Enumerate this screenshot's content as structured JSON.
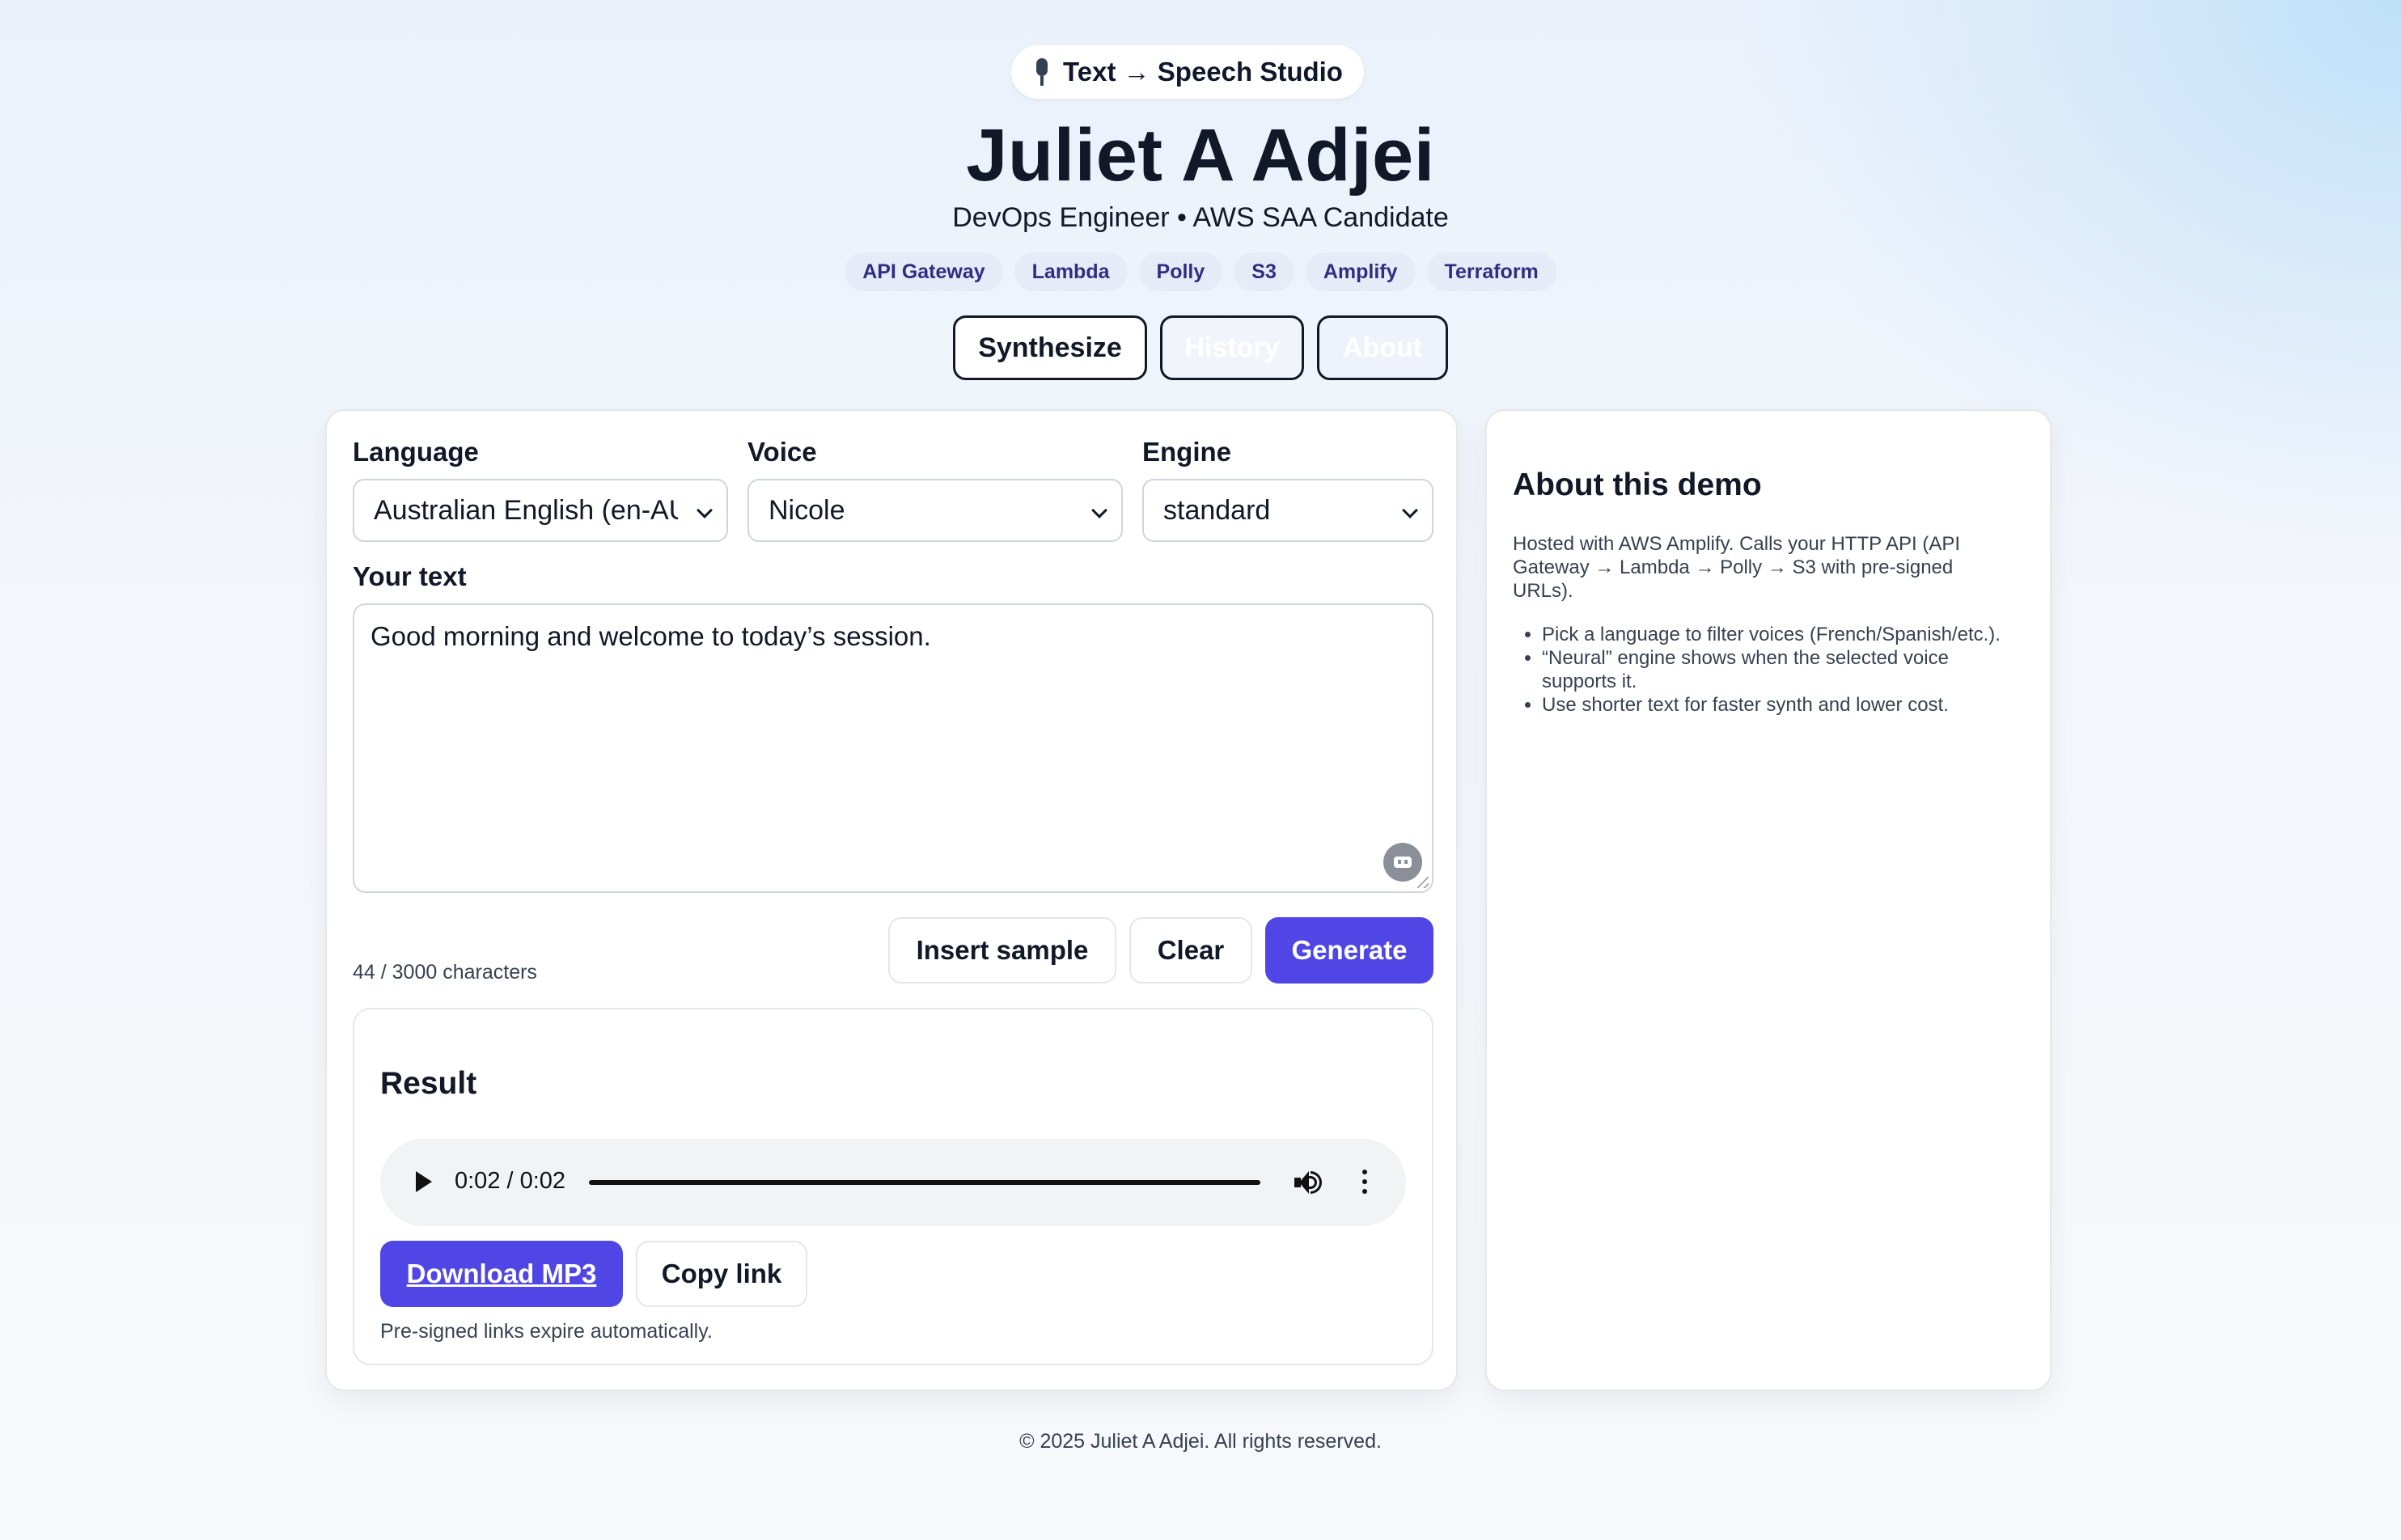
{
  "header": {
    "pill_label": "Text → Speech Studio",
    "name": "Juliet A Adjei",
    "subtitle": "DevOps Engineer • AWS SAA Candidate",
    "chips": [
      "API Gateway",
      "Lambda",
      "Polly",
      "S3",
      "Amplify",
      "Terraform"
    ]
  },
  "tabs": [
    {
      "label": "Synthesize",
      "active": true
    },
    {
      "label": "History",
      "active": false
    },
    {
      "label": "About",
      "active": false
    }
  ],
  "form": {
    "language_label": "Language",
    "language_value": "Australian English (en-AU)",
    "voice_label": "Voice",
    "voice_value": "Nicole",
    "engine_label": "Engine",
    "engine_value": "standard",
    "text_label": "Your text",
    "text_value": "Good morning and welcome to today’s session.",
    "counter": "44 / 3000 characters",
    "insert_sample_label": "Insert sample",
    "clear_label": "Clear",
    "generate_label": "Generate"
  },
  "result": {
    "heading": "Result",
    "time": "0:02 / 0:02",
    "progress": 1.0,
    "download_label": "Download MP3",
    "copy_label": "Copy link",
    "note": "Pre-signed links expire automatically."
  },
  "about": {
    "heading": "About this demo",
    "description": "Hosted with AWS Amplify. Calls your HTTP API (API Gateway → Lambda → Polly → S3 with pre-signed URLs).",
    "bullets": [
      "Pick a language to filter voices (French/Spanish/etc.).",
      "“Neural” engine shows when the selected voice supports it.",
      "Use shorter text for faster synth and lower cost."
    ]
  },
  "footer": "© 2025 Juliet A Adjei. All rights reserved.",
  "colors": {
    "accent": "#4f46e5",
    "chip_text": "#312e81"
  }
}
